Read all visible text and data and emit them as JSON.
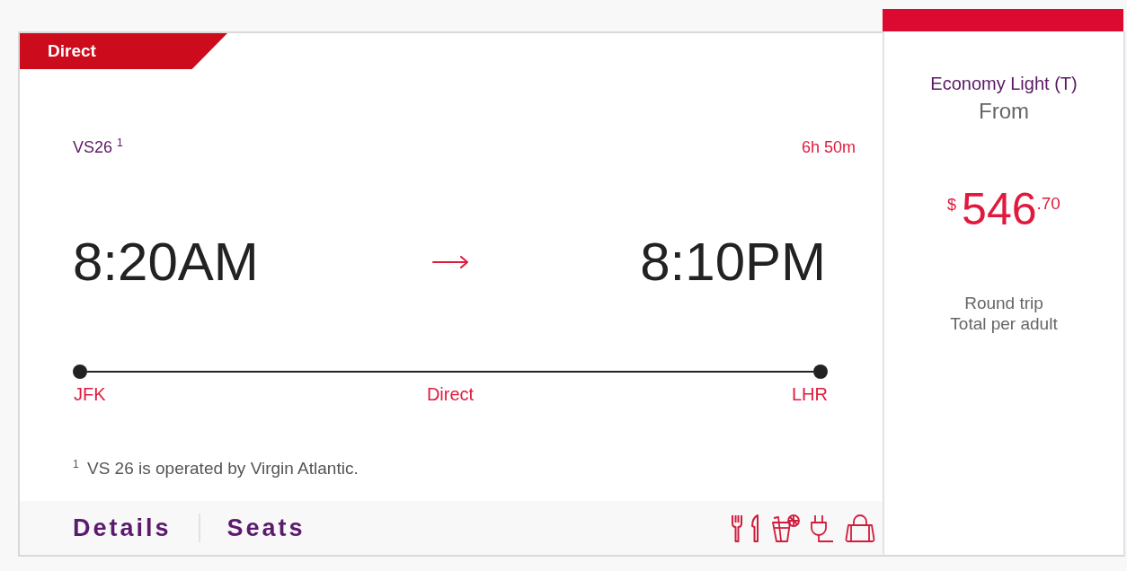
{
  "flight": {
    "badge": "Direct",
    "flight_number": "VS26 $^{1}$",
    "duration": "6h 50m",
    "departure_time": "8:20AM",
    "arrival_time": "8:10PM",
    "origin": "JFK",
    "stops": "Direct",
    "destination": "LHR",
    "footnote": "$^{1}$ VS 26 is operated by Virgin Atlantic."
  },
  "actions": [
    "Details",
    "Seats"
  ],
  "fare": {
    "cabin": "Economy Light (T)",
    "from": "From",
    "currency": "$",
    "amount": "546",
    "cents": ".70",
    "trip_type": "Round trip",
    "per_person": "Total per adult"
  }
}
